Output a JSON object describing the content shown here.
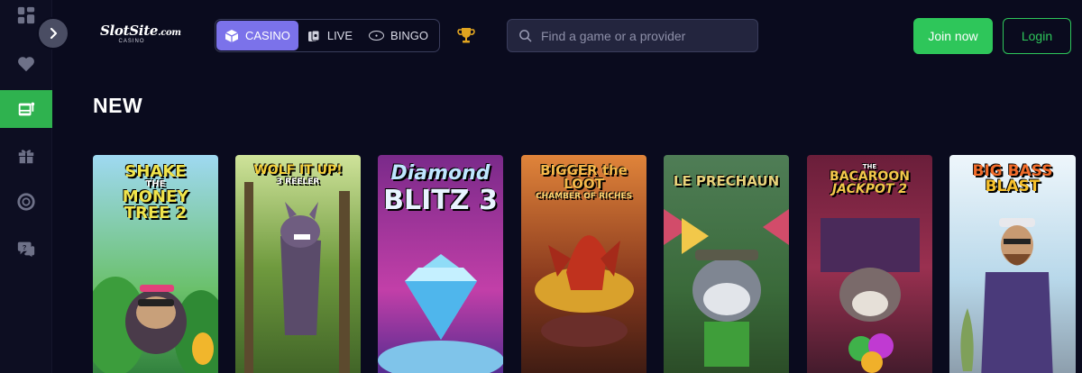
{
  "header": {
    "logo": {
      "brand": "SlotSite",
      "suffix": ".com",
      "sub": "CASINO"
    },
    "tabs": [
      {
        "label": "CASINO",
        "active": true,
        "icon": "cube-icon"
      },
      {
        "label": "LIVE",
        "active": false,
        "icon": "cards-icon"
      },
      {
        "label": "BINGO",
        "active": false,
        "icon": "bingo-icon"
      }
    ],
    "search": {
      "placeholder": "Find a game or a provider",
      "value": ""
    },
    "join_label": "Join now",
    "login_label": "Login"
  },
  "sidebar": {
    "items": [
      {
        "icon": "grid-icon"
      },
      {
        "icon": "heart-icon"
      },
      {
        "icon": "slot-machine-icon",
        "active": true
      },
      {
        "icon": "gift-icon"
      },
      {
        "icon": "lifebuoy-icon"
      },
      {
        "icon": "chat-help-icon"
      }
    ]
  },
  "section": {
    "title": "NEW"
  },
  "games": [
    {
      "title_line1": "SHAKE",
      "title_line2": "THE",
      "title_line3": "MONEY",
      "title_line4": "TREE 2"
    },
    {
      "title_line1": "WOLF IT UP!",
      "title_line2": "3 REELER"
    },
    {
      "title_line1": "Diamond",
      "title_line2": "BLITZ 3"
    },
    {
      "title_line1": "BIGGER the LOOT",
      "title_line2": "CHAMBER OF RICHES"
    },
    {
      "title_line1": "LE PRECHAUN"
    },
    {
      "title_line1": "THE",
      "title_line2": "BACAROON",
      "title_line3": "JACKPOT 2"
    },
    {
      "title_line1": "BIG BASS",
      "title_line2": "BLAST"
    }
  ],
  "colors": {
    "accent": "#7b72ea",
    "green": "#2ec65a",
    "bg": "#0a0b1e"
  }
}
